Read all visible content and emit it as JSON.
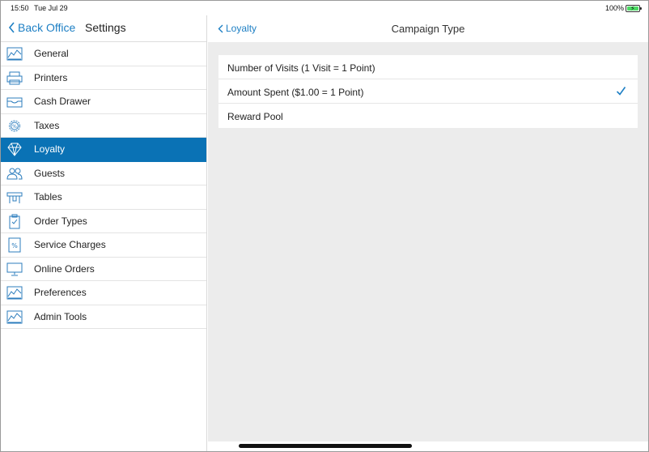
{
  "status_bar": {
    "time": "15:50",
    "date": "Tue Jul 29",
    "battery": "100%",
    "battery_icon": "battery-charging-icon"
  },
  "sidebar": {
    "back_label": "Back Office",
    "title": "Settings",
    "items": [
      {
        "label": "General",
        "icon": "chart-icon",
        "active": false
      },
      {
        "label": "Printers",
        "icon": "printer-icon",
        "active": false
      },
      {
        "label": "Cash Drawer",
        "icon": "cash-drawer-icon",
        "active": false
      },
      {
        "label": "Taxes",
        "icon": "tax-gear-icon",
        "active": false
      },
      {
        "label": "Loyalty",
        "icon": "diamond-icon",
        "active": true
      },
      {
        "label": "Guests",
        "icon": "guests-icon",
        "active": false
      },
      {
        "label": "Tables",
        "icon": "table-icon",
        "active": false
      },
      {
        "label": "Order Types",
        "icon": "clipboard-icon",
        "active": false
      },
      {
        "label": "Service Charges",
        "icon": "percent-icon",
        "active": false
      },
      {
        "label": "Online Orders",
        "icon": "monitor-icon",
        "active": false
      },
      {
        "label": "Preferences",
        "icon": "chart-icon",
        "active": false
      },
      {
        "label": "Admin Tools",
        "icon": "chart-icon",
        "active": false
      }
    ]
  },
  "main": {
    "back_label": "Loyalty",
    "title": "Campaign Type",
    "options": [
      {
        "label": "Number of Visits (1 Visit = 1 Point)",
        "selected": false
      },
      {
        "label": "Amount Spent ($1.00 = 1 Point)",
        "selected": true
      },
      {
        "label": "Reward Pool",
        "selected": false
      }
    ]
  },
  "colors": {
    "accent": "#1d7fc4",
    "active_row": "#0a72b5",
    "content_bg": "#ececec"
  }
}
